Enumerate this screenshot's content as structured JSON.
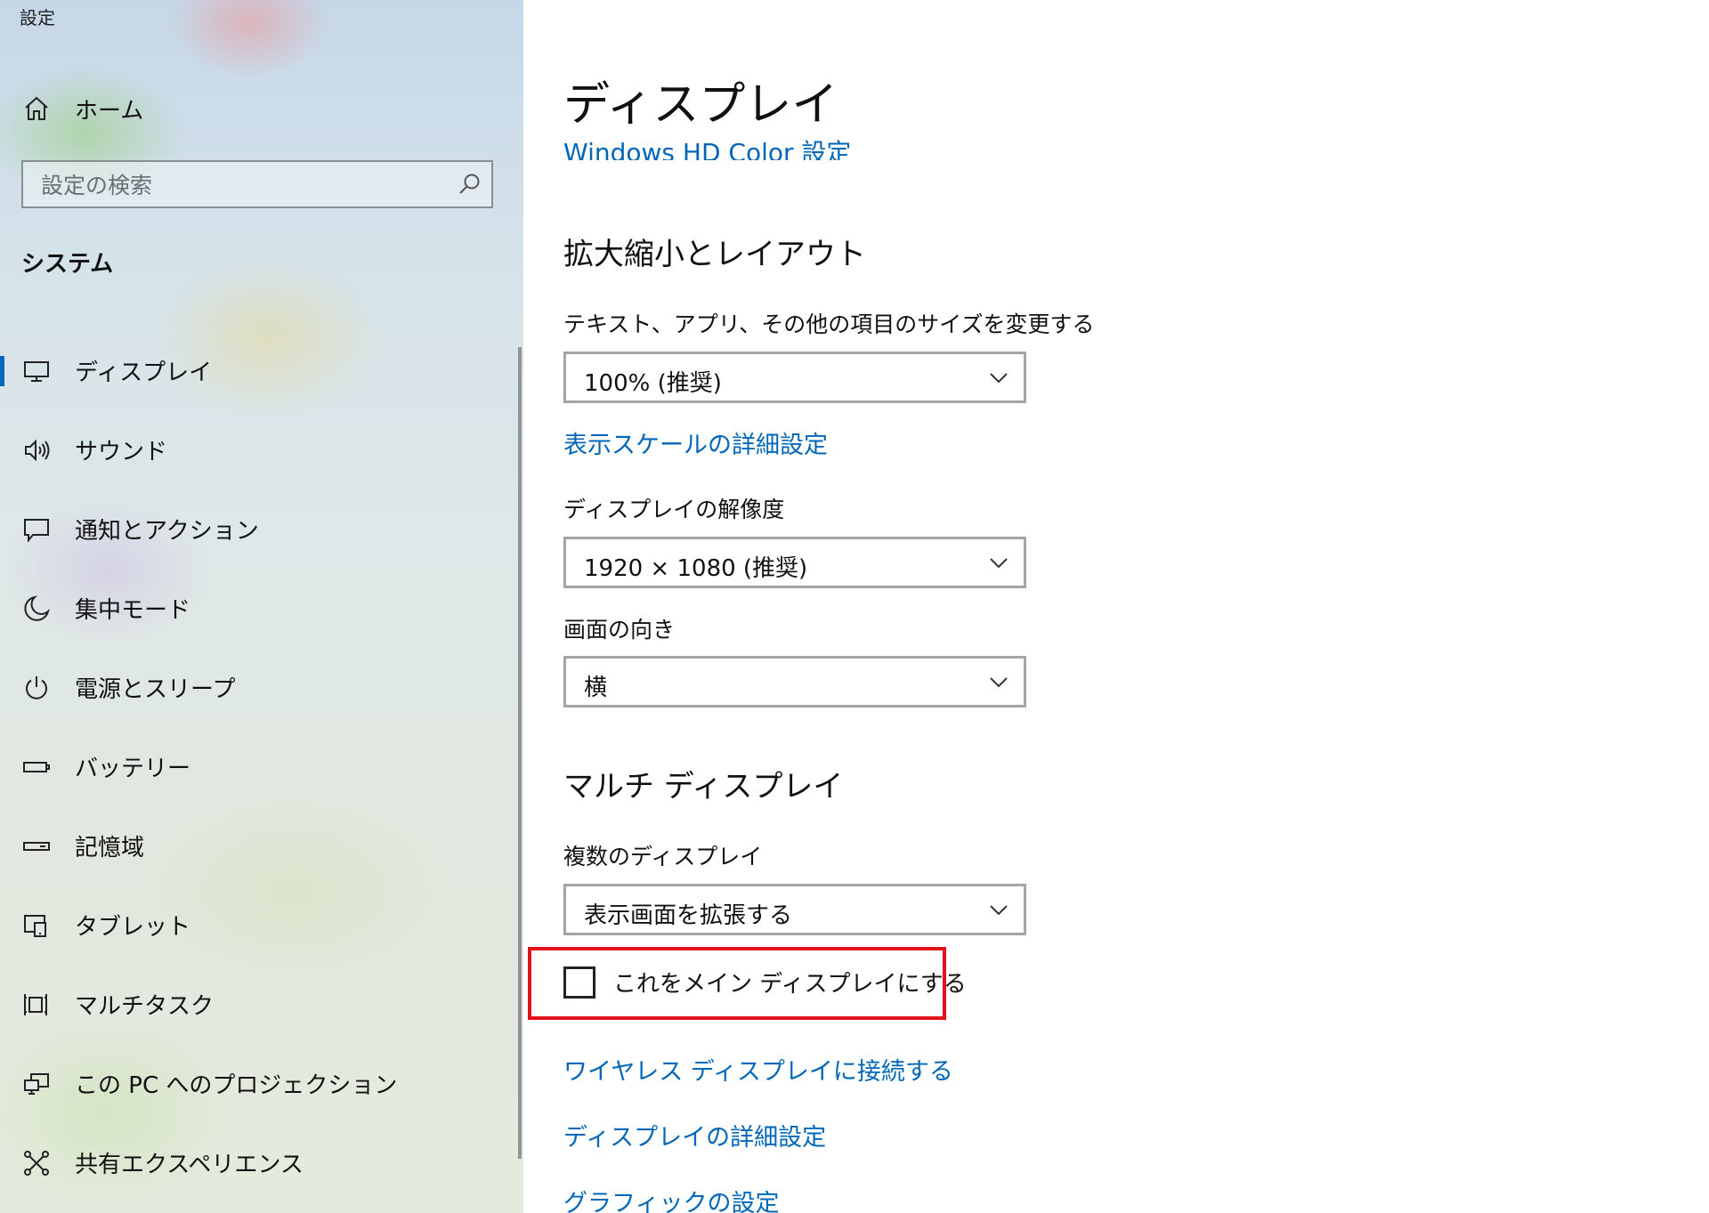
{
  "window": {
    "title": "設定"
  },
  "sidebar": {
    "home_label": "ホーム",
    "home_icon": "home-icon",
    "search": {
      "placeholder": "設定の検索",
      "value": "",
      "icon": "search-icon"
    },
    "section_heading": "システム",
    "selected_index": 0,
    "accent_color": "#0067c0",
    "items": [
      {
        "label": "ディスプレイ",
        "icon": "monitor-icon"
      },
      {
        "label": "サウンド",
        "icon": "speaker-icon"
      },
      {
        "label": "通知とアクション",
        "icon": "message-icon"
      },
      {
        "label": "集中モード",
        "icon": "moon-icon"
      },
      {
        "label": "電源とスリープ",
        "icon": "power-icon"
      },
      {
        "label": "バッテリー",
        "icon": "battery-icon"
      },
      {
        "label": "記憶域",
        "icon": "storage-icon"
      },
      {
        "label": "タブレット",
        "icon": "tablet-icon"
      },
      {
        "label": "マルチタスク",
        "icon": "multitask-icon"
      },
      {
        "label": "この PC へのプロジェクション",
        "icon": "projection-icon"
      },
      {
        "label": "共有エクスペリエンス",
        "icon": "shared-experience-icon"
      }
    ]
  },
  "main": {
    "page_title": "ディスプレイ",
    "clipped_link": "Windows HD Color 設定",
    "scale_section": {
      "heading": "拡大縮小とレイアウト",
      "size_label": "テキスト、アプリ、その他の項目のサイズを変更する",
      "size_value": "100% (推奨)",
      "scale_link": "表示スケールの詳細設定",
      "resolution_label": "ディスプレイの解像度",
      "resolution_value": "1920 × 1080 (推奨)",
      "orientation_label": "画面の向き",
      "orientation_value": "横"
    },
    "multi_section": {
      "heading": "マルチ ディスプレイ",
      "multi_label": "複数のディスプレイ",
      "multi_value": "表示画面を拡張する",
      "main_display_checkbox_label": "これをメイン ディスプレイにする",
      "main_display_checked": false,
      "wireless_link": "ワイヤレス ディスプレイに接続する",
      "advanced_link": "ディスプレイの詳細設定",
      "graphics_link": "グラフィックの設定"
    },
    "link_color": "#0067b8",
    "highlight_color": "#e3101e"
  }
}
